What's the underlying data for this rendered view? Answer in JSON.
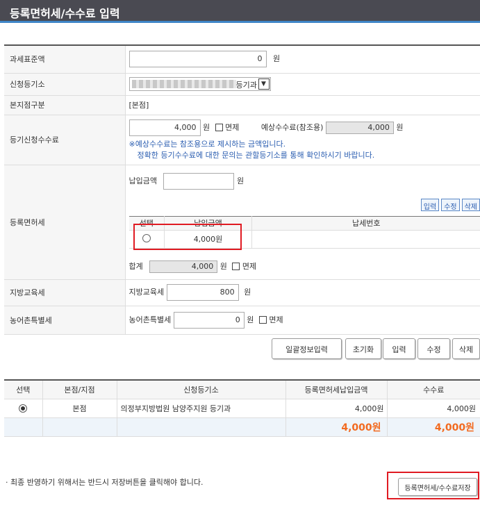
{
  "page_title": "등록면허세/수수료 입력",
  "tax_base": {
    "label": "과세표준액",
    "value": "0",
    "unit": "원"
  },
  "registry": {
    "label": "신청등기소",
    "selected": "등기과"
  },
  "division": {
    "label": "본지점구분",
    "value": "[본점]"
  },
  "fee": {
    "label": "등기신청수수료",
    "value": "4,000",
    "unit": "원",
    "exempt_label": "면제",
    "est_label": "예상수수료(참조용)",
    "est_value": "4,000",
    "est_unit": "원",
    "note1": "※예상수수료는 참조용으로 제시하는 금액입니다.",
    "note2": "정확한 등기수수료에 대한 문의는 관할등기소를 통해 확인하시기 바랍니다."
  },
  "license_tax": {
    "label": "등록면허세",
    "pay_label": "납입금액",
    "pay_value": "",
    "pay_unit": "원",
    "btn_input": "입력",
    "btn_edit": "수정",
    "btn_delete": "삭제",
    "col_select": "선택",
    "col_amount": "납입금액",
    "col_taxno": "납세번호",
    "row_amount": "4,000원",
    "row_taxno": "",
    "sum_label": "합계",
    "sum_value": "4,000",
    "sum_unit": "원",
    "exempt_label": "면제"
  },
  "edu_tax": {
    "label": "지방교육세",
    "inner_label": "지방교육세",
    "value": "800",
    "unit": "원"
  },
  "farm_tax": {
    "label": "농어촌특별세",
    "inner_label": "농어촌특별세",
    "value": "0",
    "unit": "원",
    "exempt_label": "면제"
  },
  "actions": {
    "batch": "일괄정보입력",
    "reset": "초기화",
    "input": "입력",
    "edit": "수정",
    "delete": "삭제"
  },
  "list": {
    "headers": [
      "선택",
      "본점/지점",
      "신청등기소",
      "등록면허세납입금액",
      "수수료"
    ],
    "rows": [
      {
        "division": "본점",
        "registry": "의정부지방법원 남양주지원 등기과",
        "tax": "4,000원",
        "fee": "4,000원"
      }
    ],
    "total_tax": "4,000원",
    "total_fee": "4,000원"
  },
  "notice": "· 최종 반영하기 위해서는 반드시 저장버튼을 클릭해야 합니다.",
  "save_button": "등록면허세/수수료저장"
}
